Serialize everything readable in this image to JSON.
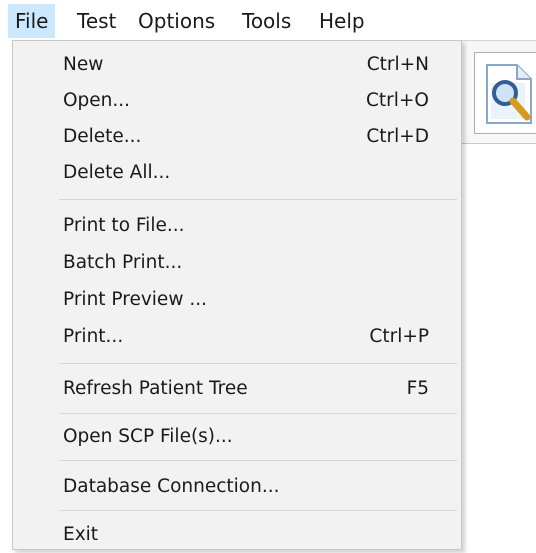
{
  "menubar": {
    "items": [
      {
        "label": "File"
      },
      {
        "label": "Test"
      },
      {
        "label": "Options"
      },
      {
        "label": "Tools"
      },
      {
        "label": "Help"
      }
    ],
    "active": "File"
  },
  "file_menu": {
    "new": {
      "label": "New",
      "shortcut": "Ctrl+N"
    },
    "open": {
      "label": "Open...",
      "shortcut": "Ctrl+O"
    },
    "delete": {
      "label": "Delete...",
      "shortcut": "Ctrl+D"
    },
    "delete_all": {
      "label": "Delete All..."
    },
    "print_to_file": {
      "label": "Print to File..."
    },
    "batch_print": {
      "label": "Batch Print..."
    },
    "print_preview": {
      "label": "Print Preview ..."
    },
    "print": {
      "label": "Print...",
      "shortcut": "Ctrl+P"
    },
    "refresh": {
      "label": "Refresh Patient Tree",
      "shortcut": "F5"
    },
    "open_scp": {
      "label": "Open SCP File(s)..."
    },
    "db_connection": {
      "label": "Database Connection..."
    },
    "exit": {
      "label": "Exit"
    }
  },
  "toolbar": {
    "icons": [
      "search-document-icon"
    ]
  },
  "colors": {
    "menu_background": "#f2f2f2",
    "active_menu_highlight": "#cce8ff",
    "separator": "#d7d7d7"
  }
}
